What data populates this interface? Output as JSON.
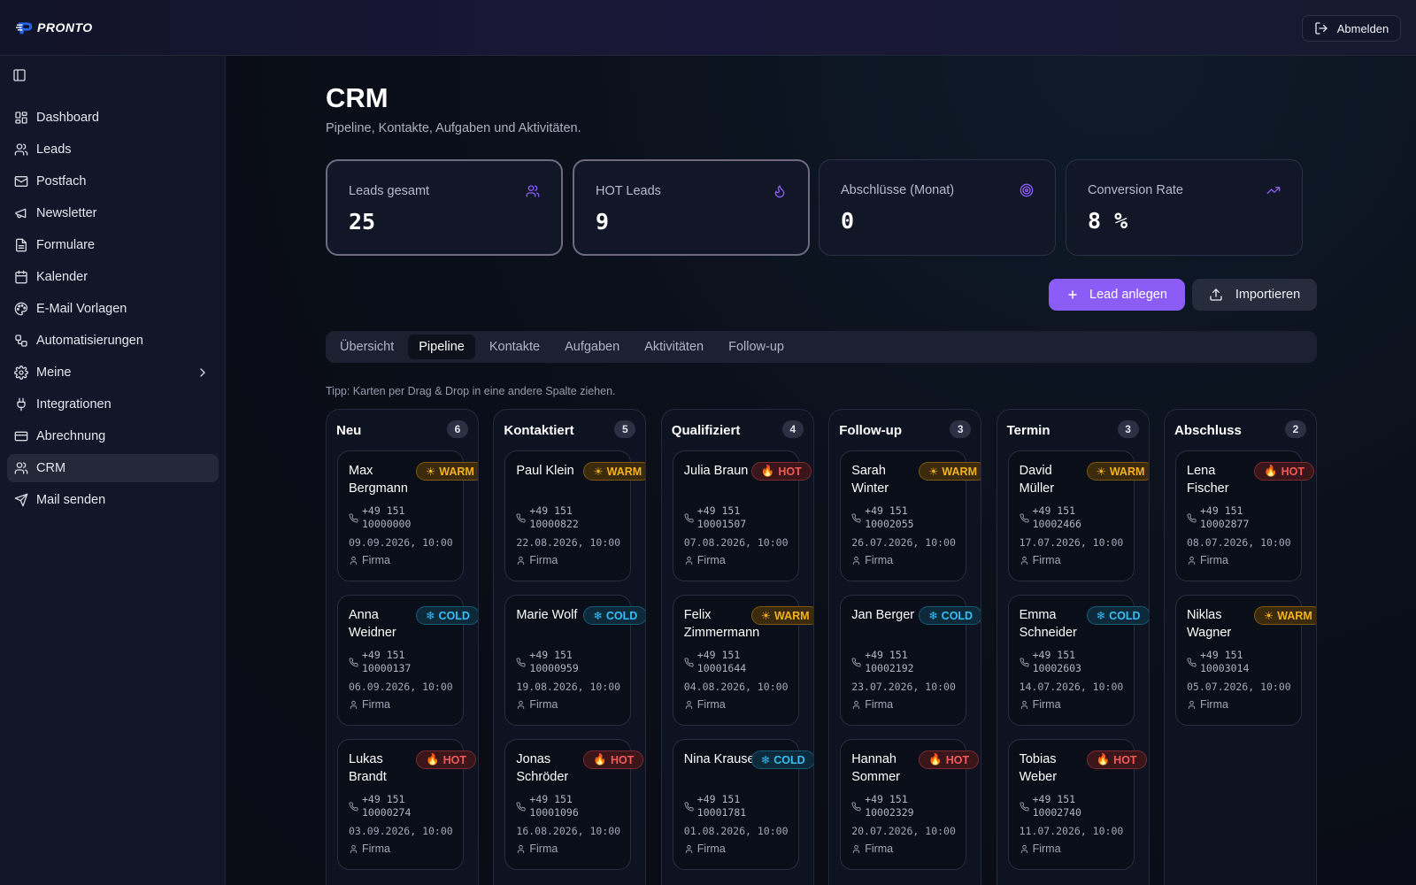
{
  "brand": {
    "name": "PRONTO",
    "accent": "#8b5cf6"
  },
  "topbar": {
    "logout_label": "Abmelden"
  },
  "sidebar": {
    "items": [
      {
        "label": "Dashboard",
        "icon": "dashboard-icon"
      },
      {
        "label": "Leads",
        "icon": "users-icon"
      },
      {
        "label": "Postfach",
        "icon": "mail-icon"
      },
      {
        "label": "Newsletter",
        "icon": "megaphone-icon"
      },
      {
        "label": "Formulare",
        "icon": "file-icon"
      },
      {
        "label": "Kalender",
        "icon": "calendar-icon"
      },
      {
        "label": "E-Mail Vorlagen",
        "icon": "palette-icon"
      },
      {
        "label": "Automatisierungen",
        "icon": "workflow-icon"
      },
      {
        "label": "Meine",
        "icon": "gear-icon"
      },
      {
        "label": "Integrationen",
        "icon": "plug-icon"
      },
      {
        "label": "Abrechnung",
        "icon": "credit-card-icon"
      },
      {
        "label": "CRM",
        "icon": "users-icon"
      },
      {
        "label": "Mail senden",
        "icon": "send-icon"
      }
    ],
    "active": "CRM"
  },
  "page": {
    "title": "CRM",
    "subtitle": "Pipeline, Kontakte, Aufgaben und Aktivitäten."
  },
  "stats": [
    {
      "label": "Leads gesamt",
      "value": "25",
      "icon": "users-icon"
    },
    {
      "label": "HOT Leads",
      "value": "9",
      "icon": "flame-icon"
    },
    {
      "label": "Abschlüsse (Monat)",
      "value": "0",
      "icon": "target-icon"
    },
    {
      "label": "Conversion Rate",
      "value": "8 %",
      "icon": "trending-up-icon"
    }
  ],
  "actions": {
    "add_lead": "Lead anlegen",
    "import": "Importieren"
  },
  "tabs": [
    "Übersicht",
    "Pipeline",
    "Kontakte",
    "Aufgaben",
    "Aktivitäten",
    "Follow-up"
  ],
  "active_tab": "Pipeline",
  "tip": "Tipp: Karten per Drag & Drop in eine andere Spalte ziehen.",
  "badge_labels": {
    "hot": "HOT",
    "warm": "WARM",
    "cold": "COLD"
  },
  "badge_colors": {
    "hot": "#f35a5a",
    "warm": "#f3b21e",
    "cold": "#38bdf8"
  },
  "firm_label": "Firma",
  "columns": [
    {
      "title": "Neu",
      "count": "6",
      "cards": [
        {
          "name": "Max Bergmann",
          "badge": "warm",
          "phone": "+49 151 10000000",
          "date": "09.09.2026, 10:00"
        },
        {
          "name": "Anna Weidner",
          "badge": "cold",
          "phone": "+49 151 10000137",
          "date": "06.09.2026, 10:00"
        },
        {
          "name": "Lukas Brandt",
          "badge": "hot",
          "phone": "+49 151 10000274",
          "date": "03.09.2026, 10:00"
        }
      ]
    },
    {
      "title": "Kontaktiert",
      "count": "5",
      "cards": [
        {
          "name": "Paul Klein",
          "badge": "warm",
          "phone": "+49 151 10000822",
          "date": "22.08.2026, 10:00"
        },
        {
          "name": "Marie Wolf",
          "badge": "cold",
          "phone": "+49 151 10000959",
          "date": "19.08.2026, 10:00"
        },
        {
          "name": "Jonas Schröder",
          "badge": "hot",
          "phone": "+49 151 10001096",
          "date": "16.08.2026, 10:00"
        }
      ]
    },
    {
      "title": "Qualifiziert",
      "count": "4",
      "cards": [
        {
          "name": "Julia Braun",
          "badge": "hot",
          "phone": "+49 151 10001507",
          "date": "07.08.2026, 10:00"
        },
        {
          "name": "Felix Zimmermann",
          "badge": "warm",
          "phone": "+49 151 10001644",
          "date": "04.08.2026, 10:00"
        },
        {
          "name": "Nina Krause",
          "badge": "cold",
          "phone": "+49 151 10001781",
          "date": "01.08.2026, 10:00"
        }
      ]
    },
    {
      "title": "Follow-up",
      "count": "3",
      "cards": [
        {
          "name": "Sarah Winter",
          "badge": "warm",
          "phone": "+49 151 10002055",
          "date": "26.07.2026, 10:00"
        },
        {
          "name": "Jan Berger",
          "badge": "cold",
          "phone": "+49 151 10002192",
          "date": "23.07.2026, 10:00"
        },
        {
          "name": "Hannah Sommer",
          "badge": "hot",
          "phone": "+49 151 10002329",
          "date": "20.07.2026, 10:00"
        }
      ]
    },
    {
      "title": "Termin",
      "count": "3",
      "cards": [
        {
          "name": "David Müller",
          "badge": "warm",
          "phone": "+49 151 10002466",
          "date": "17.07.2026, 10:00"
        },
        {
          "name": "Emma Schneider",
          "badge": "cold",
          "phone": "+49 151 10002603",
          "date": "14.07.2026, 10:00"
        },
        {
          "name": "Tobias Weber",
          "badge": "hot",
          "phone": "+49 151 10002740",
          "date": "11.07.2026, 10:00"
        }
      ]
    },
    {
      "title": "Abschluss",
      "count": "2",
      "cards": [
        {
          "name": "Lena Fischer",
          "badge": "hot",
          "phone": "+49 151 10002877",
          "date": "08.07.2026, 10:00"
        },
        {
          "name": "Niklas Wagner",
          "badge": "warm",
          "phone": "+49 151 10003014",
          "date": "05.07.2026, 10:00"
        }
      ]
    }
  ]
}
